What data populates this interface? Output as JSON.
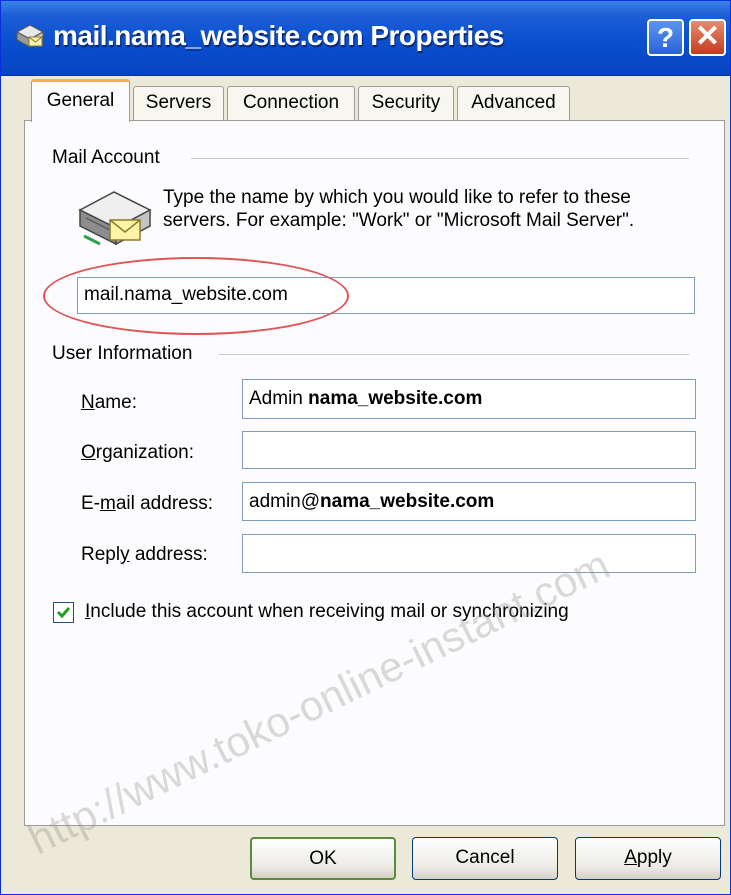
{
  "window": {
    "title": "mail.nama_website.com Properties",
    "help_label": "?",
    "close_label": "✕"
  },
  "tabs": [
    {
      "label": "General",
      "active": true
    },
    {
      "label": "Servers",
      "active": false
    },
    {
      "label": "Connection",
      "active": false
    },
    {
      "label": "Security",
      "active": false
    },
    {
      "label": "Advanced",
      "active": false
    }
  ],
  "mail_account": {
    "group_label": "Mail Account",
    "description": "Type the name by which you would like to refer to these servers.  For example: \"Work\" or \"Microsoft Mail Server\".",
    "account_name": "mail.nama_website.com"
  },
  "user_information": {
    "group_label": "User Information",
    "name": {
      "label_ul": "N",
      "label_rest": "ame:",
      "value_plain": "Admin ",
      "value_bold": "nama_website.com"
    },
    "organization": {
      "label_ul": "O",
      "label_rest": "rganization:",
      "value": ""
    },
    "email": {
      "label_pre": "E-",
      "label_ul": "m",
      "label_rest": "ail address:",
      "value_plain": "admin@",
      "value_bold": "nama_website.com"
    },
    "reply": {
      "label_pre": "Repl",
      "label_ul": "y",
      "label_rest": " address:",
      "value": ""
    }
  },
  "include_account": {
    "checked": true,
    "label_ul": "I",
    "label_rest": "nclude this account when receiving mail or synchronizing"
  },
  "buttons": {
    "ok": "OK",
    "cancel": "Cancel",
    "apply_ul": "A",
    "apply_rest": "pply"
  },
  "watermark": "http://www.toko-online-instant.com",
  "colors": {
    "title_bar": "#0a4fcf",
    "dialog_bg": "#ece9d8",
    "active_tab_accent": "#f3b33e",
    "highlight_ellipse": "#e05555"
  },
  "icons": {
    "title": "mail-server-icon",
    "account": "mail-server-envelope-icon"
  }
}
